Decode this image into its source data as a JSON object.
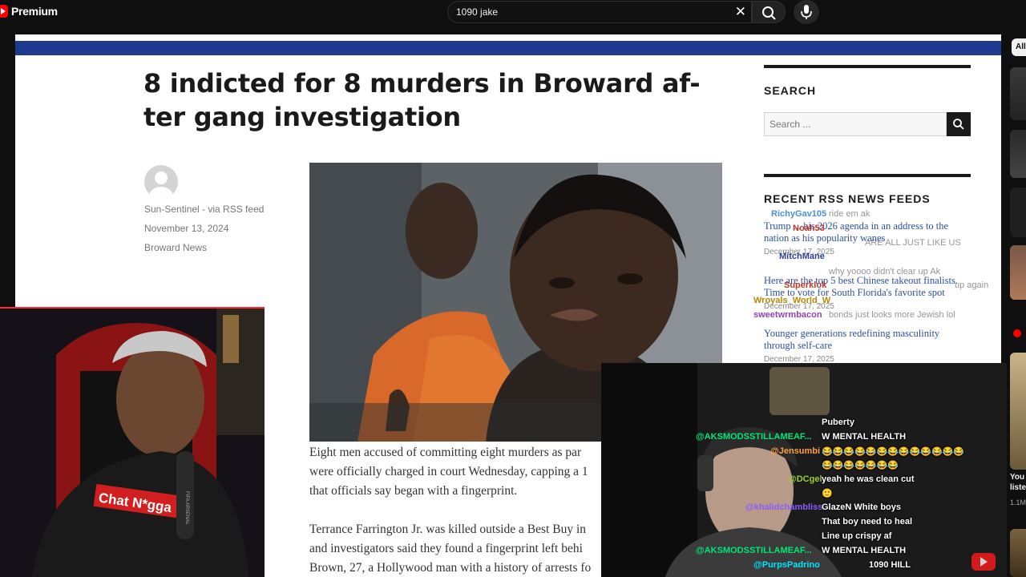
{
  "youtube": {
    "logo_text": "Premium",
    "search_value": "1090 jake",
    "right_rail": {
      "chip_all": "All",
      "video_title_partial": "You",
      "video_title_partial2": "liste",
      "views_partial": "1.1M"
    }
  },
  "article": {
    "title": "8 indicted for 8 murders in Broward af-ter gang investigation",
    "author": "Sun-Sentinel - via RSS feed",
    "date": "November 13, 2024",
    "category": "Broward News",
    "body_lines": [
      "Eight men accused of committing eight murders as par",
      "were officially charged in court Wednesday, capping a 1",
      "that officials say began with a fingerprint.",
      "",
      "Terrance Farrington Jr. was killed outside a Best Buy in",
      "and investigators said they found a fingerprint left behi",
      "Brown, 27, a Hollywood man with a history of arrests fo"
    ]
  },
  "sidebar": {
    "search_title": "SEARCH",
    "search_placeholder": "Search ...",
    "feeds_title": "RECENT RSS NEWS FEEDS",
    "feeds": [
      {
        "title": "Trump ... his 2026 agenda in an address to the nation as his popularity wanes",
        "date": "December 17, 2025"
      },
      {
        "title": "Here are the top 5 best Chinese takeout finalists. Time to vote for South Florida's favorite spot",
        "date": "December 17, 2025"
      },
      {
        "title": "Younger generations redefining masculinity through self-care",
        "date": "December 17, 2025"
      }
    ]
  },
  "stream_chat": [
    {
      "user": "RichyGav105",
      "msg": "ride em ak",
      "color": "#4a90d9"
    },
    {
      "user": "Noah53",
      "msg": "",
      "color": "#c0392b"
    },
    {
      "user": "",
      "msg": "ARE ALL JUST LIKE US",
      "color": "#9b59b6"
    },
    {
      "user": "MitchMane",
      "msg": "",
      "color": "#2c3e9f"
    },
    {
      "user": "",
      "msg": "why yoooo didn't clear up Ak",
      "color": "#27ae60"
    },
    {
      "user": "Superklok",
      "msg": "up again",
      "color": "#c0392b"
    },
    {
      "user": "Wroyals_World_W",
      "msg": "",
      "color": "#b8860b"
    },
    {
      "user": "sweetwrmbacon",
      "msg": "bonds just looks more Jewish lol",
      "color": "#8e44ad"
    }
  ],
  "video_chat": [
    {
      "user": "",
      "text": "Puberty",
      "color": "#ff7f50"
    },
    {
      "user": "@AKSMODSSTILLAMEAF...",
      "text": "W MENTAL HEALTH",
      "color": "#00e676"
    },
    {
      "user": "@Jensumbi",
      "text": "😂😂😂😂😂😂😂😂😂😂😂😂😂",
      "color": "#ff9f43"
    },
    {
      "user": "",
      "text": "😂😂😂😂😂😂😂",
      "color": "#ff9f43"
    },
    {
      "user": "@DCgel",
      "text": "yeah he was clean cut",
      "color": "#9acd32"
    },
    {
      "user": "",
      "text": "🙂",
      "color": "#ffd700"
    },
    {
      "user": "@khalidchambliss",
      "text": "GlazeN White boys",
      "color": "#8a5cff"
    },
    {
      "user": "",
      "text": "That boy need to heal",
      "color": "#ff7f50"
    },
    {
      "user": "",
      "text": "Line up crispy af",
      "color": "#ff5e5e"
    },
    {
      "user": "@AKSMODSSTILLAMEAF...",
      "text": "W MENTAL HEALTH",
      "color": "#00e676"
    },
    {
      "user": "@PurpsPadrino",
      "text": "1090 HILL",
      "color": "#00e5ff"
    }
  ],
  "webcam_shirt_text": "Chat N*gga",
  "mic_label": "FIFA ARSENAL"
}
